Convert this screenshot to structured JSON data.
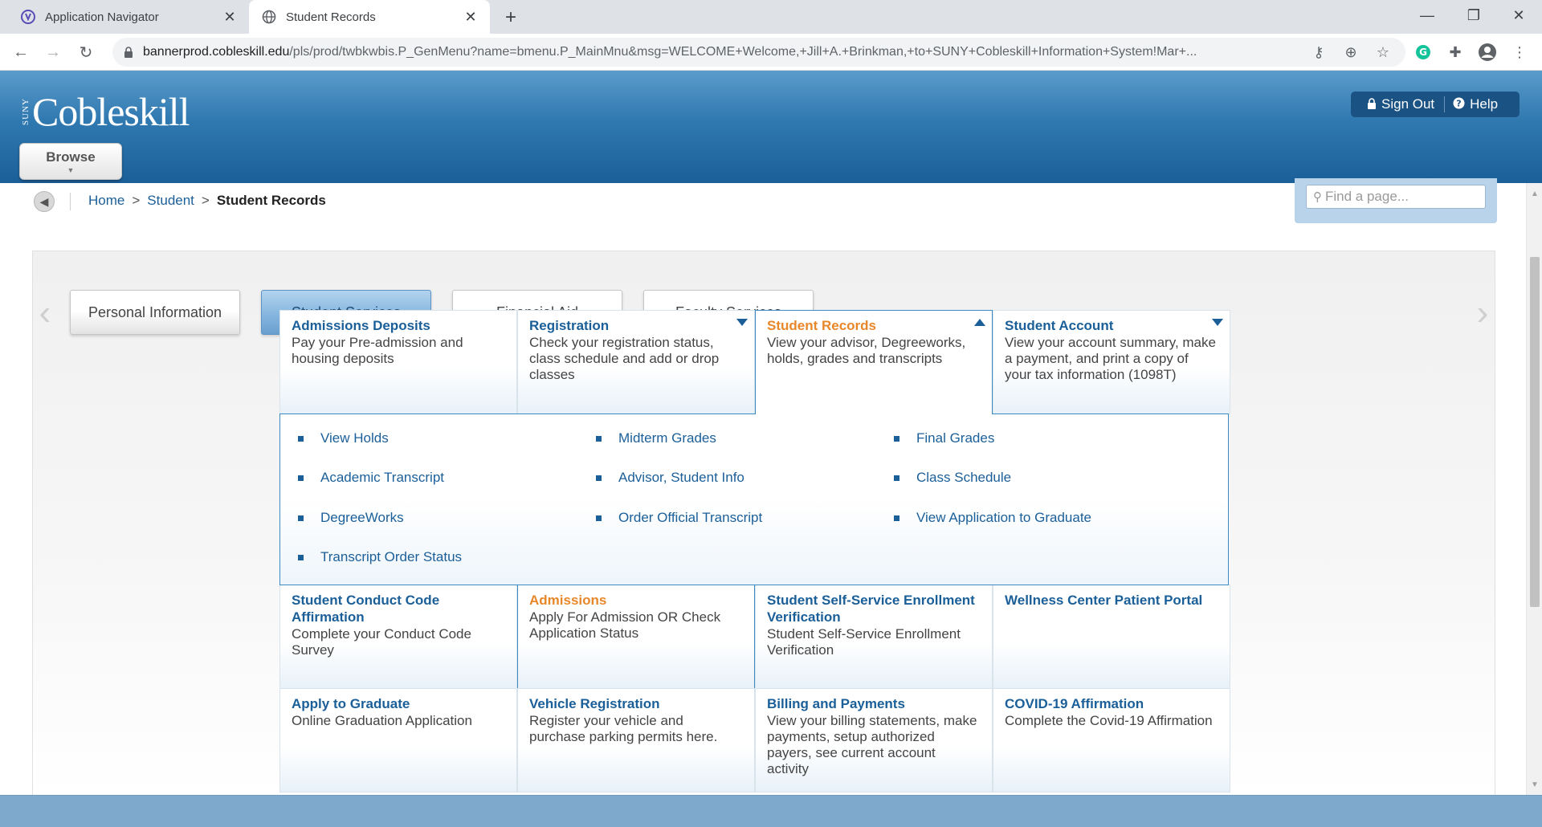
{
  "browser": {
    "tabs": [
      {
        "title": "Application Navigator",
        "active": false
      },
      {
        "title": "Student Records",
        "active": true
      }
    ],
    "url_host": "bannerprod.cobleskill.edu",
    "url_rest": "/pls/prod/twbkwbis.P_GenMenu?name=bmenu.P_MainMnu&msg=WELCOME+Welcome,+Jill+A.+Brinkman,+to+SUNY+Cobleskill+Information+System!Mar+..."
  },
  "header": {
    "logo_small": "SUNY",
    "logo_name": "Cobleskill",
    "browse_label": "Browse",
    "sign_out_label": "Sign Out",
    "help_label": "Help",
    "accent_color": "#1b5f99"
  },
  "breadcrumb": {
    "items": [
      "Home",
      "Student"
    ],
    "current": "Student Records"
  },
  "search": {
    "placeholder": "Find a page..."
  },
  "menu_tabs": [
    {
      "label": "Personal Information",
      "selected": false
    },
    {
      "label": "Student Services",
      "selected": true
    },
    {
      "label": "Financial Aid",
      "selected": false
    },
    {
      "label": "Faculty Services",
      "selected": false
    }
  ],
  "cards_row1": [
    {
      "title": "Admissions Deposits",
      "desc": "Pay your Pre-admission and housing deposits"
    },
    {
      "title": "Registration",
      "desc": "Check your registration status, class schedule and add or drop classes"
    },
    {
      "title": "Student Records",
      "desc": "View your advisor, Degreeworks, holds, grades and transcripts"
    },
    {
      "title": "Student Account",
      "desc": "View your account summary, make a payment, and print a copy of your tax information (1098T)"
    }
  ],
  "submenu": [
    [
      "View Holds",
      "Midterm Grades",
      "Final Grades"
    ],
    [
      "Academic Transcript",
      "Advisor, Student Info",
      "Class Schedule"
    ],
    [
      "DegreeWorks",
      "Order Official Transcript",
      "View Application to Graduate"
    ],
    [
      "Transcript Order Status"
    ]
  ],
  "cards_row2": [
    {
      "title": "Student Conduct Code Affirmation",
      "desc": "Complete your Conduct Code Survey"
    },
    {
      "title": "Admissions",
      "desc": "Apply For Admission OR Check Application Status"
    },
    {
      "title": "Student Self-Service Enrollment Verification",
      "desc": "Student Self-Service Enrollment Verification"
    },
    {
      "title": "Wellness Center Patient Portal",
      "desc": ""
    }
  ],
  "cards_row3": [
    {
      "title": "Apply to Graduate",
      "desc": "Online Graduation Application"
    },
    {
      "title": "Vehicle Registration",
      "desc": "Register your vehicle and purchase parking permits here."
    },
    {
      "title": "Billing and Payments",
      "desc": "View your billing statements, make payments, setup authorized payers, see current account activity"
    },
    {
      "title": "COVID-19 Affirmation",
      "desc": "Complete the Covid-19 Affirmation"
    }
  ]
}
